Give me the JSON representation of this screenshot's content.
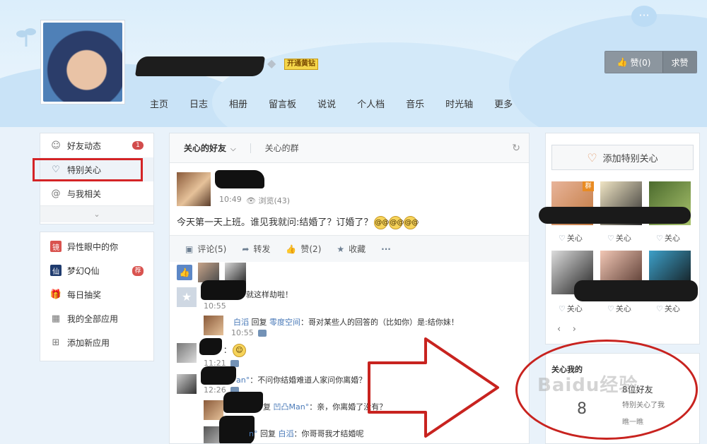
{
  "header": {
    "vip_badge": "开通黄钻",
    "nav": [
      "主页",
      "日志",
      "相册",
      "留言板",
      "说说",
      "个人档",
      "音乐",
      "时光轴",
      "更多"
    ],
    "like_button": "赞(0)",
    "beg_button": "求赞"
  },
  "sidebar": {
    "items": [
      {
        "label": "好友动态",
        "icon": "person-icon",
        "badge": "1"
      },
      {
        "label": "特别关心",
        "icon": "heart-icon",
        "badge": ""
      },
      {
        "label": "与我相关",
        "icon": "at-icon",
        "badge": ""
      }
    ],
    "apps": [
      {
        "label": "异性眼中的你",
        "icon": "mirror-app-icon",
        "badge": ""
      },
      {
        "label": "梦幻Q仙",
        "icon": "qxian-app-icon",
        "badge": "荐"
      },
      {
        "label": "每日抽奖",
        "icon": "gift-icon",
        "badge": ""
      },
      {
        "label": "我的全部应用",
        "icon": "grid-icon",
        "badge": ""
      },
      {
        "label": "添加新应用",
        "icon": "plus-icon",
        "badge": ""
      }
    ]
  },
  "feed": {
    "tabs": [
      "关心的好友",
      "关心的群"
    ],
    "post": {
      "time": "10:49",
      "views": "浏览(43)",
      "text": "今天第一天上班。谁见我就问:结婚了？订婚了？"
    },
    "actions": [
      "评论(5)",
      "转发",
      "赞(2)",
      "收藏",
      "···"
    ],
    "comments": [
      {
        "text": "就这样劫啦！",
        "time": "10:55"
      },
      {
        "name": "白滔",
        "verb": "回复",
        "target": "零度空间",
        "text": "：哥对某些人的回答的（比如你）是:结你妹！",
        "time": "10:55"
      },
      {
        "text": "：",
        "time": "11:21"
      },
      {
        "name": "an°",
        "text": "：不问你结婚难道人家问你离婚？",
        "time": "12:26"
      },
      {
        "verb": "复",
        "target": "凹凸Man°",
        "text": "：亲，你离婚了没有？"
      },
      {
        "name": "n°",
        "verb": "回复",
        "target": "白滔",
        "text": "：你哥哥我才结婚呢"
      }
    ]
  },
  "right": {
    "add_special": "添加特别关心",
    "care_label": "关心",
    "group_tag": "群",
    "care_me_title": "关心我的",
    "care_count": "8位好友",
    "care_sub": "特别关心了我",
    "care_big": "8",
    "care_foot": "瞧一瞧",
    "watermark": "Baidu经验"
  }
}
